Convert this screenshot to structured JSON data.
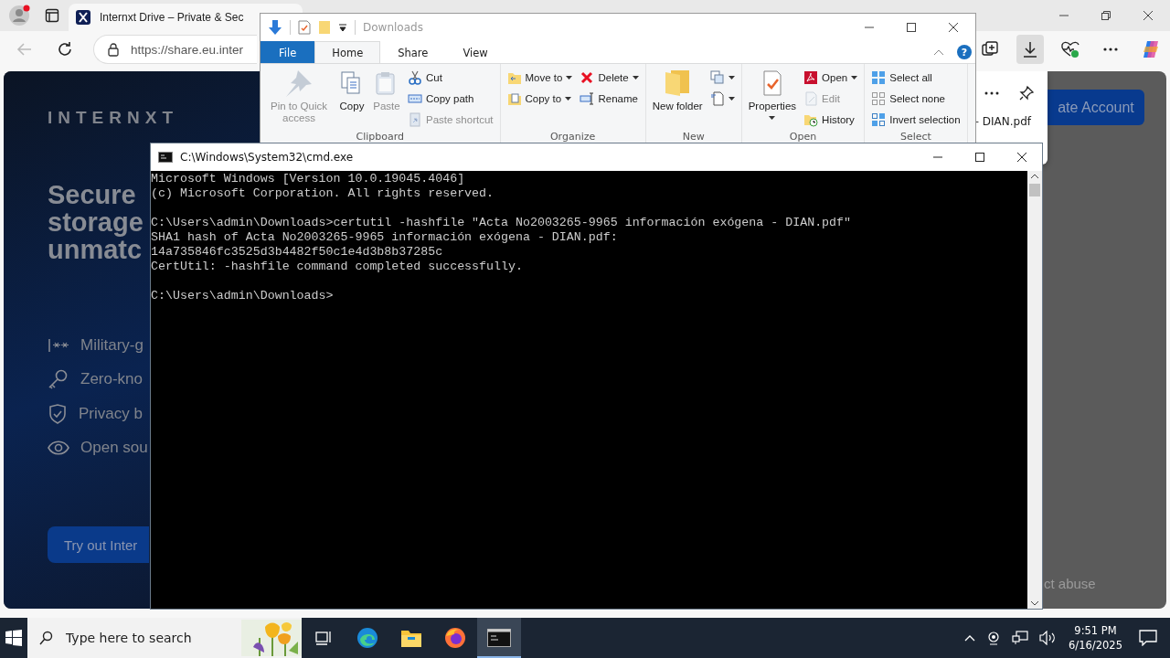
{
  "browser": {
    "tab": {
      "title": "Internxt Drive – Private & Sec",
      "selected": true
    },
    "address": {
      "url": "https://share.eu.inter"
    },
    "toolbar_buttons": [
      {
        "kind": "collections",
        "selected": false
      },
      {
        "kind": "downloads",
        "selected": true
      },
      {
        "kind": "health",
        "selected": false
      },
      {
        "kind": "more",
        "selected": false
      },
      {
        "kind": "copilot",
        "selected": false
      }
    ]
  },
  "page": {
    "logo": "INTERNXT",
    "heading": [
      "Secure",
      "storage",
      "unmatc"
    ],
    "features": [
      {
        "kind": "password",
        "text": "Military-g"
      },
      {
        "kind": "key",
        "text": "Zero-kno"
      },
      {
        "kind": "shield",
        "text": "Privacy b"
      },
      {
        "kind": "eye",
        "text": "Open sou"
      }
    ],
    "cta": "Try out Inter",
    "account_button": "ate Account",
    "report_link": "ct abuse"
  },
  "downloads_panel": {
    "file": "– DIAN.pdf"
  },
  "explorer": {
    "title": "Downloads",
    "help": "?",
    "tabs": [
      {
        "label": "File",
        "kind": "file",
        "selected": false
      },
      {
        "label": "Home",
        "kind": "tab",
        "selected": true
      },
      {
        "label": "Share",
        "kind": "tab",
        "selected": false
      },
      {
        "label": "View",
        "kind": "tab",
        "selected": false
      }
    ],
    "groups": [
      {
        "name": "Clipboard",
        "items": [
          {
            "label": "Pin to Quick access",
            "kind": "large",
            "disabled": true,
            "dropdown": false
          },
          {
            "label": "Copy",
            "kind": "large",
            "disabled": false,
            "dropdown": false
          },
          {
            "label": "Paste",
            "kind": "large",
            "disabled": true,
            "dropdown": false
          },
          {
            "label": "Cut",
            "kind": "small",
            "disabled": false,
            "dropdown": false
          },
          {
            "label": "Copy path",
            "kind": "small",
            "disabled": false,
            "dropdown": false
          },
          {
            "label": "Paste shortcut",
            "kind": "small",
            "disabled": true,
            "dropdown": false
          }
        ]
      },
      {
        "name": "Organize",
        "items": [
          {
            "label": "Move to",
            "kind": "small",
            "disabled": false,
            "dropdown": true
          },
          {
            "label": "Copy to",
            "kind": "small",
            "disabled": false,
            "dropdown": true
          },
          {
            "label": "Delete",
            "kind": "small",
            "disabled": false,
            "dropdown": true
          },
          {
            "label": "Rename",
            "kind": "small",
            "disabled": false,
            "dropdown": false
          }
        ]
      },
      {
        "name": "New",
        "items": [
          {
            "label": "New folder",
            "kind": "large",
            "disabled": false,
            "dropdown": false
          },
          {
            "kind": "small",
            "disabled": false,
            "dropdown": true
          },
          {
            "kind": "small",
            "disabled": false,
            "dropdown": true
          }
        ]
      },
      {
        "name": "Open",
        "items": [
          {
            "label": "Properties",
            "kind": "large",
            "disabled": false,
            "dropdown": true
          },
          {
            "label": "Open",
            "kind": "small",
            "disabled": false,
            "dropdown": true
          },
          {
            "label": "Edit",
            "kind": "small",
            "disabled": true,
            "dropdown": false
          },
          {
            "label": "History",
            "kind": "small",
            "disabled": false,
            "dropdown": false
          }
        ]
      },
      {
        "name": "Select",
        "items": [
          {
            "label": "Select all",
            "kind": "small",
            "disabled": false,
            "dropdown": false
          },
          {
            "label": "Select none",
            "kind": "small",
            "disabled": false,
            "dropdown": false
          },
          {
            "label": "Invert selection",
            "kind": "small",
            "disabled": false,
            "dropdown": false
          }
        ]
      }
    ]
  },
  "cmd": {
    "title": "C:\\Windows\\System32\\cmd.exe",
    "blocks": [
      [
        "Microsoft Windows [Version 10.0.19045.4046]",
        "(c) Microsoft Corporation. All rights reserved."
      ],
      [
        "C:\\Users\\admin\\Downloads>certutil -hashfile \"Acta No2003265-9965 información exógena - DIAN.pdf\"",
        "SHA1 hash of Acta No2003265-9965 información exógena - DIAN.pdf:",
        "14a735846fc3525d3b4482f50c1e4d3b8b37285c",
        "CertUtil: -hashfile command completed successfully."
      ],
      [
        "C:\\Users\\admin\\Downloads>"
      ]
    ]
  },
  "taskbar": {
    "search_placeholder": "Type here to search",
    "apps": [
      {
        "kind": "task-view",
        "selected": false
      },
      {
        "kind": "edge",
        "selected": false
      },
      {
        "kind": "explorer",
        "selected": false
      },
      {
        "kind": "firefox",
        "selected": false
      },
      {
        "kind": "cmd",
        "selected": true
      }
    ],
    "time": "9:51 PM",
    "date": "6/16/2025"
  }
}
